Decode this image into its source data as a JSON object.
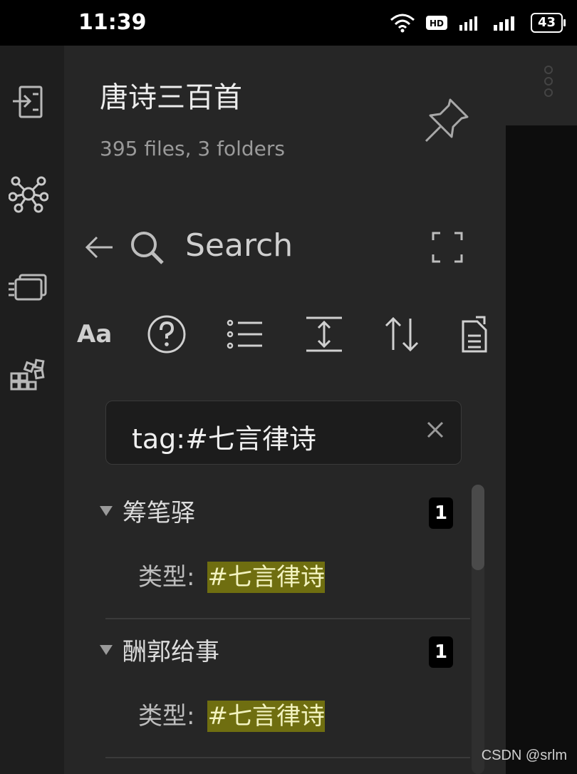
{
  "status_bar": {
    "time": "11:39",
    "icons": [
      "wifi-icon",
      "hd-icon",
      "signal-4g-icon",
      "signal-5g-icon"
    ],
    "hd_label": "HD",
    "battery": "43"
  },
  "ribbon": {
    "items": [
      "file-explorer-icon",
      "graph-view-icon",
      "slides-icon",
      "plugins-icon"
    ]
  },
  "vault": {
    "name": "唐诗三百首",
    "stats": "395 files, 3 folders"
  },
  "search": {
    "title": "Search",
    "query": "tag:#七言律诗",
    "toolbar": {
      "match_case_label": "Aa",
      "items": [
        "match-case-icon",
        "help-icon",
        "collapse-results-icon",
        "show-more-context-icon",
        "sort-icon",
        "copy-results-icon"
      ]
    },
    "results": [
      {
        "file": "筹笔驿",
        "count": "1",
        "prefix": "类型:",
        "match": "#七言律诗"
      },
      {
        "file": "酬郭给事",
        "count": "1",
        "prefix": "类型:",
        "match": "#七言律诗"
      }
    ]
  },
  "colors": {
    "panel": "#262626",
    "ribbon": "#1e1e1e",
    "highlight": "#6f6e10"
  },
  "watermark": "CSDN @srlm"
}
